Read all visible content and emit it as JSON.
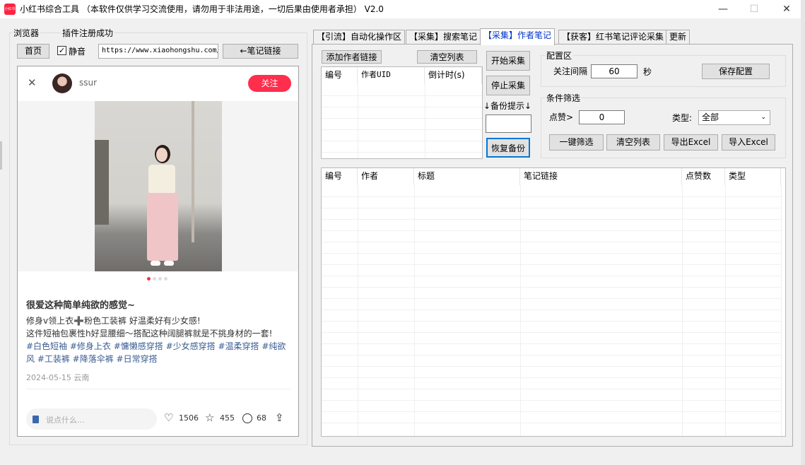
{
  "window": {
    "icon_text": "小红书",
    "title": "小红书综合工具   （本软件仅供学习交流使用，请勿用于非法用途，一切后果由使用者承担）  V2.0",
    "minimize": "—",
    "maximize": "☐",
    "close": "✕"
  },
  "left_panel": {
    "browser_label": "浏览器",
    "plugin_status": "插件注册成功",
    "home_button": "首页",
    "mute_checkbox_label": "静音",
    "mute_checked": true,
    "url_value": "https://www.xiaohongshu.com/",
    "note_link_button": "←笔记链接"
  },
  "note": {
    "close_icon": "✕",
    "username": "ssur",
    "follow_button": "关注",
    "title": "很爱这种简单纯欲的感觉~",
    "body_line1": "修身v领上衣➕粉色工装裤 好温柔好有少女感!",
    "body_line2": "这件短袖包裹性h好显腰细～搭配这种阔腿裤就是不挑身材的一套!",
    "hashtags_line1": "#白色短袖 #修身上衣 #慵懒感穿搭 #少女感穿搭 #温柔穿搭 #纯欲",
    "hashtags_line2": "风 #工装裤 #降落伞裤 #日常穿搭",
    "date_location": "2024-05-15 云南",
    "comment_placeholder": "说点什么...",
    "likes": "1506",
    "stars": "455",
    "comments": "68"
  },
  "tabs": [
    {
      "label": "【引流】自动化操作区",
      "active": false
    },
    {
      "label": "【采集】搜索笔记",
      "active": false
    },
    {
      "label": "【采集】作者笔记",
      "active": true
    },
    {
      "label": "【获客】红书笔记评论采集",
      "active": false
    },
    {
      "label": "更新",
      "active": false
    }
  ],
  "author_tab": {
    "add_author_button": "添加作者链接",
    "clear_list_button": "清空列表",
    "author_columns": [
      "编号",
      "作者UID",
      "倒计时(s)"
    ],
    "start_button": "开始采集",
    "stop_button": "停止采集",
    "backup_hint": "↓备份提示↓",
    "backup_value": "",
    "restore_button": "恢复备份",
    "config_title": "配置区",
    "interval_label": "关注间隔",
    "interval_value": "60",
    "seconds_label": "秒",
    "save_config_button": "保存配置",
    "filter_title": "条件筛选",
    "likes_label": "点赞>",
    "likes_value": "0",
    "type_label": "类型:",
    "type_value": "全部",
    "one_click_filter_button": "一键筛选",
    "clear_list2_button": "清空列表",
    "export_excel_button": "导出Excel",
    "import_excel_button": "导入Excel",
    "result_columns": [
      "编号",
      "作者",
      "标题",
      "笔记链接",
      "点赞数",
      "类型"
    ]
  }
}
